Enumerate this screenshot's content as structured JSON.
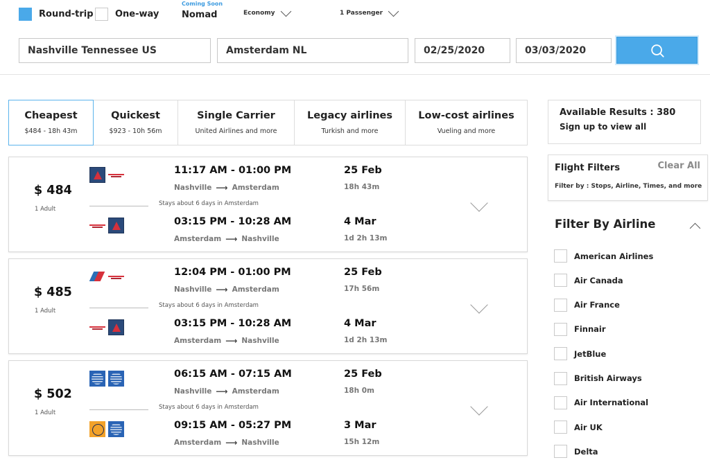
{
  "search": {
    "trip_types": [
      {
        "label": "Round-trip",
        "selected": true
      },
      {
        "label": "One-way",
        "selected": false
      }
    ],
    "nomad_badge": "Coming Soon",
    "nomad_label": "Nomad",
    "cabin": "Economy",
    "passengers": "1 Passenger",
    "origin": "Nashville Tennessee US",
    "destination": "Amsterdam  NL",
    "depart_date": "02/25/2020",
    "return_date": "03/03/2020",
    "search_icon": "search-icon",
    "accent_color": "#4aa9e9"
  },
  "tabs": [
    {
      "title": "Cheapest",
      "subtitle": "$484 - 18h 43m",
      "active": true
    },
    {
      "title": "Quickest",
      "subtitle": "$923 - 10h 56m",
      "active": false
    },
    {
      "title": "Single Carrier",
      "subtitle": "United Airlines and more",
      "active": false
    },
    {
      "title": "Legacy airlines",
      "subtitle": "Turkish and more",
      "active": false
    },
    {
      "title": "Low-cost airlines",
      "subtitle": "Vueling and more",
      "active": false
    }
  ],
  "flights": [
    {
      "price": "$ 484",
      "passengers": "1 Adult",
      "stay_note": "Stays about 6 days in Amsterdam",
      "outbound": {
        "time": "11:17 AM - 01:00 PM",
        "from": "Nashville",
        "to": "Amsterdam",
        "date": "25 Feb",
        "duration": "18h 43m",
        "logos": [
          "delta",
          "wordmark"
        ]
      },
      "return": {
        "time": "03:15 PM - 10:28 AM",
        "from": "Amsterdam",
        "to": "Nashville",
        "date": "4 Mar",
        "duration": "1d 2h 13m",
        "logos": [
          "wordmark",
          "delta"
        ]
      }
    },
    {
      "price": "$ 485",
      "passengers": "1 Adult",
      "stay_note": "Stays about 6 days in Amsterdam",
      "outbound": {
        "time": "12:04 PM - 01:00 PM",
        "from": "Nashville",
        "to": "Amsterdam",
        "date": "25 Feb",
        "duration": "17h 56m",
        "logos": [
          "aa",
          "wordmark"
        ]
      },
      "return": {
        "time": "03:15 PM - 10:28 AM",
        "from": "Amsterdam",
        "to": "Nashville",
        "date": "4 Mar",
        "duration": "1d 2h 13m",
        "logos": [
          "wordmark",
          "delta"
        ]
      }
    },
    {
      "price": "$ 502",
      "passengers": "1 Adult",
      "stay_note": "Stays about 6 days in Amsterdam",
      "outbound": {
        "time": "06:15 AM - 07:15 AM",
        "from": "Nashville",
        "to": "Amsterdam",
        "date": "25 Feb",
        "duration": "18h 0m",
        "logos": [
          "united",
          "united"
        ]
      },
      "return": {
        "time": "09:15 AM - 05:27 PM",
        "from": "Amsterdam",
        "to": "Nashville",
        "date": "3 Mar",
        "duration": "15h 12m",
        "logos": [
          "lufthansa",
          "united"
        ]
      }
    }
  ],
  "sidebar": {
    "results_text": "Available Results : 380",
    "signup_text": "Sign up to view all",
    "filters_title": "Flight Filters",
    "clear_all": "Clear All",
    "filters_subtitle": "Filter by : Stops, Airline, Times, and more",
    "airline_filter_title": "Filter By Airline",
    "airlines": [
      "American Airlines",
      "Air Canada",
      "Air France",
      "Finnair",
      "JetBlue",
      "British Airways",
      "Air International",
      "Air UK",
      "Delta"
    ]
  }
}
